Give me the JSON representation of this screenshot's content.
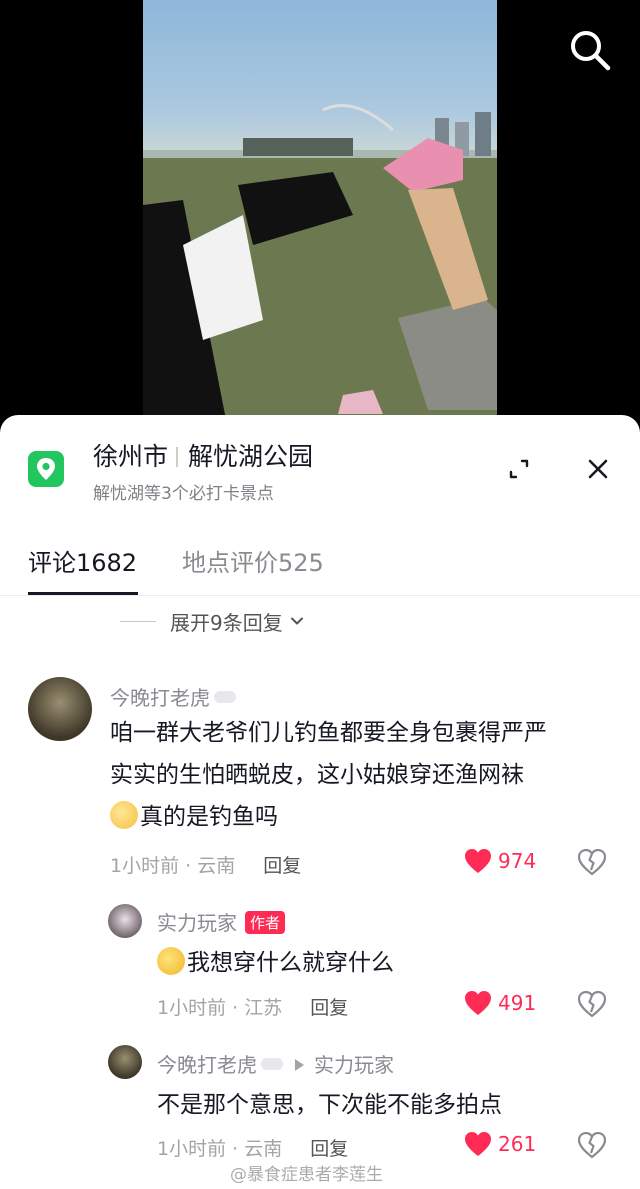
{
  "location": {
    "city": "徐州市",
    "place": "解忧湖公园",
    "subtitle": "解忧湖等3个必打卡景点"
  },
  "tabs": [
    {
      "label": "评论",
      "count": "1682",
      "active": true
    },
    {
      "label": "地点评价",
      "count": "525",
      "active": false
    }
  ],
  "expand_replies": "展开9条回复",
  "comments": [
    {
      "username": "今晚打老虎",
      "text_line1": "咱一群大老爷们儿钓鱼都要全身包裹得严严",
      "text_line2": "实实的生怕晒蜕皮，这小姑娘穿还渔网袜",
      "text_line3": "真的是钓鱼吗",
      "time": "1小时前",
      "region": "云南",
      "reply_label": "回复",
      "likes": "974"
    },
    {
      "username": "实力玩家",
      "badge": "作者",
      "text": "我想穿什么就穿什么",
      "time": "1小时前",
      "region": "江苏",
      "reply_label": "回复",
      "likes": "491"
    },
    {
      "username": "今晚打老虎",
      "reply_to": "实力玩家",
      "text": "不是那个意思，下次能不能多拍点",
      "time": "1小时前",
      "region": "云南",
      "reply_label": "回复",
      "likes": "261"
    }
  ],
  "meta_separator": "·",
  "watermark": "@暴食症患者李莲生",
  "colors": {
    "accent": "#fe2c55",
    "pin": "#22c55e"
  }
}
